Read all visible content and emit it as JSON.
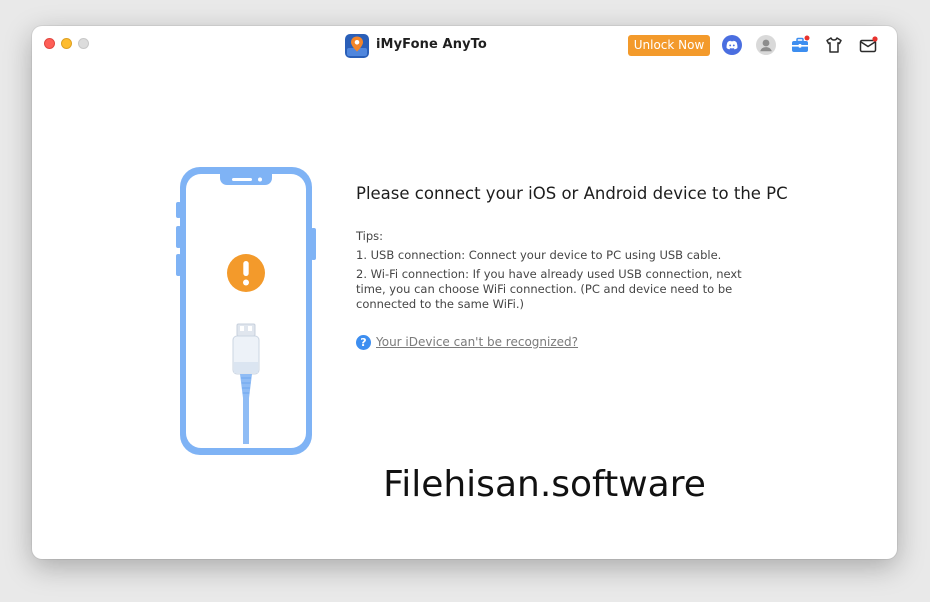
{
  "window": {
    "title": "iMyFone AnyTo"
  },
  "toolbar": {
    "unlock_label": "Unlock Now",
    "icons": [
      "discord-icon",
      "account-icon",
      "toolbox-icon",
      "tshirt-icon",
      "mail-icon"
    ],
    "accent_color": "#f39a2b",
    "badge_color": "#e8322d"
  },
  "main": {
    "headline": "Please connect your iOS or Android device to the PC",
    "tips_title": "Tips:",
    "tips": [
      "1. USB connection: Connect your device to PC using USB cable.",
      "2. Wi-Fi connection: If you have already used USB connection, next",
      "time, you can choose WiFi connection. (PC and device need to be",
      "connected to the same WiFi.)"
    ],
    "help_link": "Your iDevice can't be recognized?",
    "illustration": {
      "phone_color": "#7fb3f5",
      "warning_color": "#f39a2b",
      "warning_icon": "exclamation-icon"
    }
  },
  "watermark": "Filehisan.software"
}
